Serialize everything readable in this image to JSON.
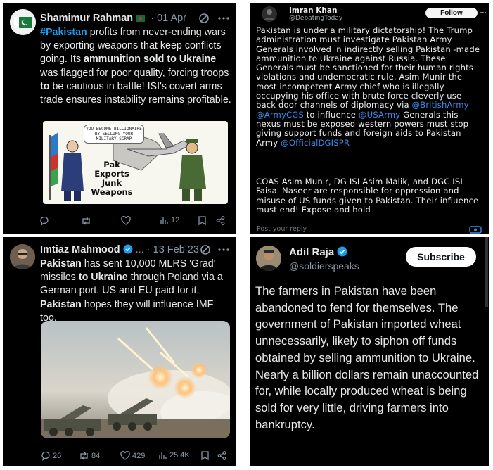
{
  "tweet1": {
    "author": "Shamimur Rahman",
    "sep": "·",
    "date": "01 Apr",
    "body": [
      {
        "t": "#Pakistan",
        "s": "hl"
      },
      {
        "t": " profits from never-ending wars by exporting weapons that keep conflicts going. Its ",
        "s": ""
      },
      {
        "t": "ammunition sold to Ukraine",
        "s": "bold"
      },
      {
        "t": " was flagged for poor quality, forcing troops ",
        "s": ""
      },
      {
        "t": "to",
        "s": "bold"
      },
      {
        "t": " be cautious in battle! ISI's covert arms trade ensures instability remains profitable.",
        "s": ""
      }
    ],
    "cartoon": {
      "bubble": "YOU BECOME BILLIONAIRE BY SELLING YOUR MILITARY SCRAP",
      "caption": "Pak Exports Junk Weapons"
    },
    "views": "12",
    "accent": "#1d9bf0"
  },
  "tweet2": {
    "author": "Imran Khan",
    "handle": "@DebatingToday",
    "follow_label": "Follow",
    "para1": [
      {
        "t": "Pakistan is under a military dictatorship! The Trump administration must investigate Pakistan Army Generals involved in indirectly selling Pakistani-made ammunition to Ukraine against Russia. These Generals must be sanctioned for their human rights violations and undemocratic rule. Asim Munir the most incompetent Army chief who is illegally occupying his  office with brute force  cleverly use back door channels of diplomacy via ",
        "s": ""
      },
      {
        "t": "@BritishArmy",
        "s": "lnk"
      },
      {
        "t": " ",
        "s": ""
      },
      {
        "t": "@ArmyCGS",
        "s": "lnk"
      },
      {
        "t": "  to influence ",
        "s": ""
      },
      {
        "t": "@USArmy",
        "s": "lnk"
      },
      {
        "t": "  Generals this nexus must be exposed western powers must stop giving support funds and foreign aids to Pakistan Army ",
        "s": ""
      },
      {
        "t": "@OfficialDGISPR",
        "s": "lnk"
      }
    ],
    "para2": "COAS Asim Munir, DG ISI Asim Malik, and DGC ISI Faisal Naseer are responsible for oppression and misuse of US funds given to Pakistan. Their influence must end! Expose and hold",
    "reply_placeholder": "Post your reply"
  },
  "tweet3": {
    "author": "Imtiaz Mahmood",
    "sep": "... · 13 Feb 23",
    "body": [
      {
        "t": "Pakistan",
        "s": "bold"
      },
      {
        "t": " has sent 10,000 MLRS 'Grad' missiles ",
        "s": ""
      },
      {
        "t": "to Ukraine",
        "s": "bold"
      },
      {
        "t": " through Poland via a German port. US and EU paid for it. ",
        "s": ""
      },
      {
        "t": "Pakistan",
        "s": "bold"
      },
      {
        "t": " hopes they will influence IMF too.",
        "s": ""
      }
    ],
    "replies": "26",
    "reposts": "84",
    "likes": "429",
    "views": "25.4K"
  },
  "tweet4": {
    "author": "Adil Raja",
    "handle": "@soldierspeaks",
    "subscribe_label": "Subscribe",
    "body": "The farmers in Pakistan have been abandoned to fend for themselves. The government of Pakistan imported wheat unnecessarily, likely to siphon off funds obtained by selling ammunition to Ukraine. Nearly a billion dollars remain unaccounted for, while locally produced wheat is being sold for very little, driving farmers into bankruptcy."
  }
}
